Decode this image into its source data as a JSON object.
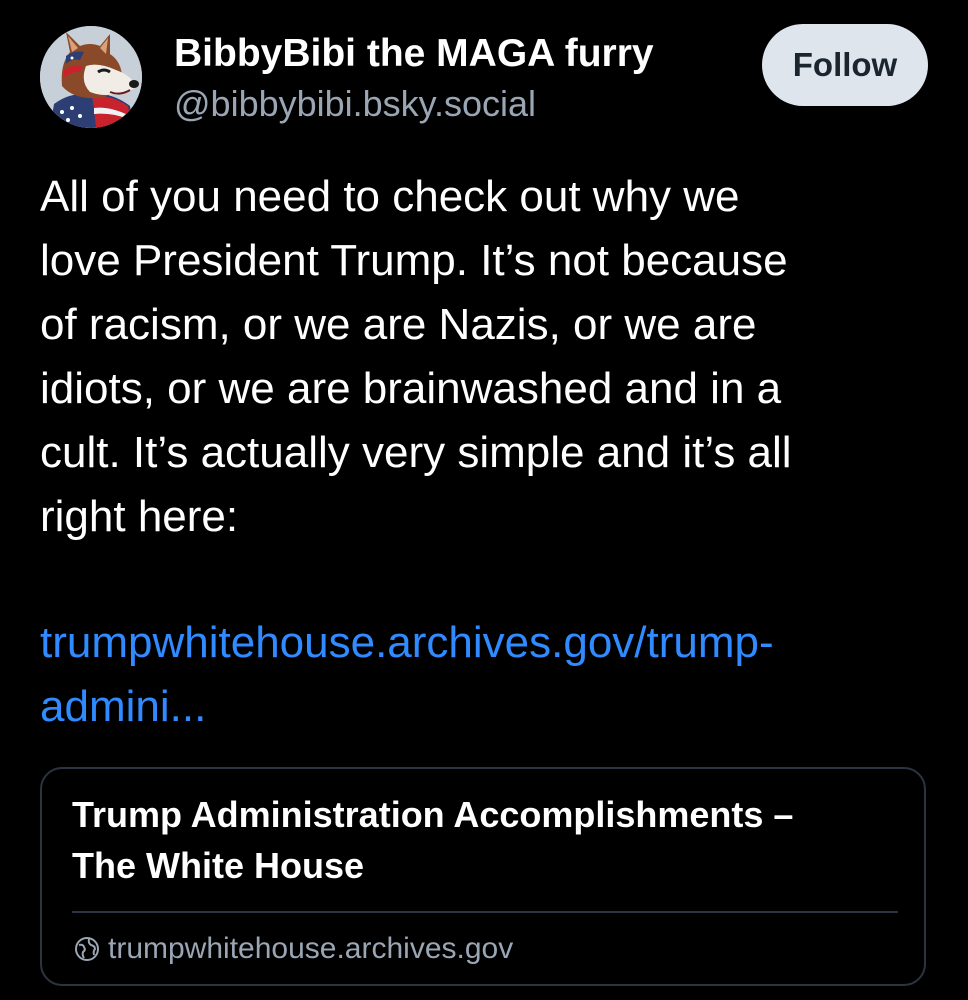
{
  "author": {
    "display_name": "BibbyBibi the MAGA furry",
    "handle": "@bibbybibi.bsky.social",
    "avatar_icon": "furry-wolf-avatar-icon"
  },
  "follow_button": {
    "label": "Follow"
  },
  "post": {
    "text_lines": [
      "All of you need to check out why we",
      "love President Trump.  It’s not because",
      "of racism, or we are Nazis, or we are",
      "idiots, or we are brainwashed and in a",
      "cult.  It’s actually very simple and it’s all",
      "right here:"
    ],
    "link_lines": [
      "trumpwhitehouse.archives.gov/trump-",
      "admini..."
    ]
  },
  "embed": {
    "title_lines": [
      "Trump Administration Accomplishments –",
      "The White House"
    ],
    "domain": "trumpwhitehouse.archives.gov",
    "domain_icon": "globe-icon"
  },
  "colors": {
    "background": "#000000",
    "text": "#ffffff",
    "secondary_text": "#9aa6b4",
    "link": "#2f8bff",
    "follow_bg": "#dfe5ec",
    "border": "#2b3440"
  }
}
